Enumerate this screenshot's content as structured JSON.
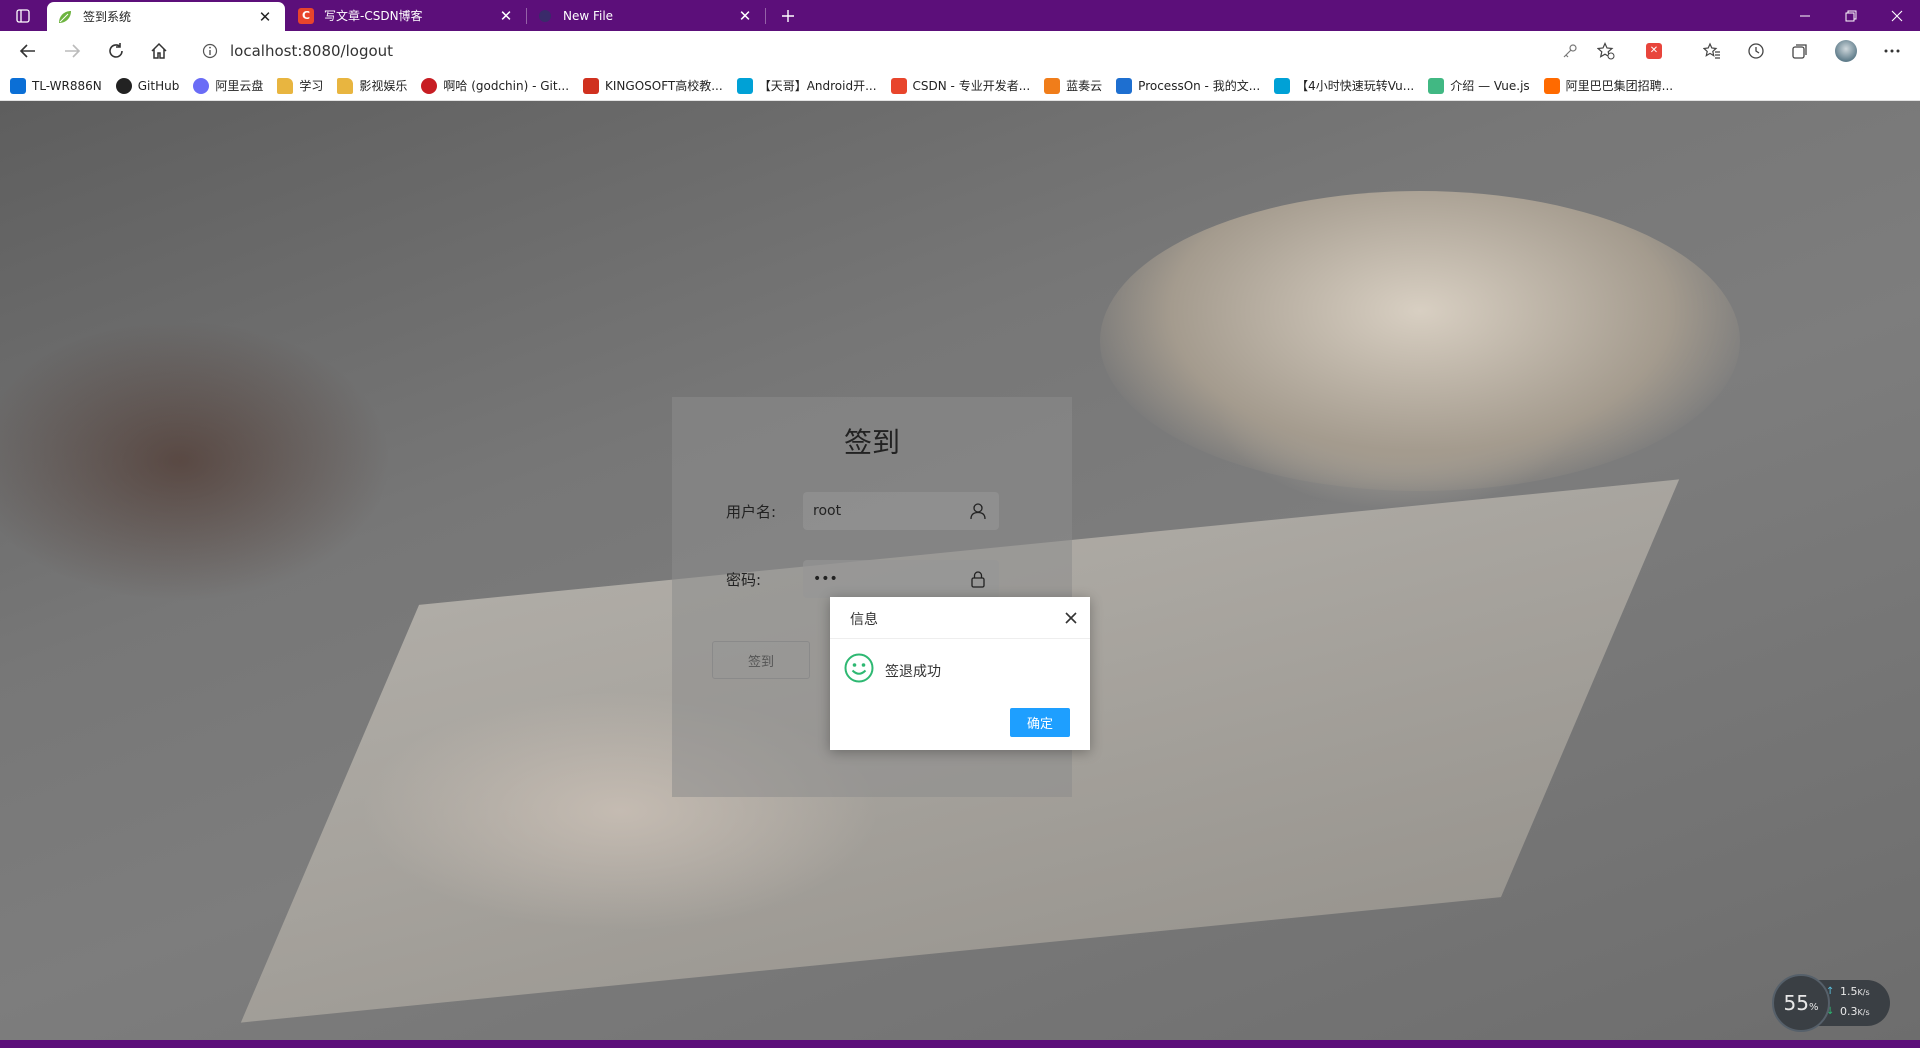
{
  "tabs": [
    {
      "label": "签到系统",
      "active": true
    },
    {
      "label": "写文章-CSDN博客",
      "active": false
    },
    {
      "label": "New File",
      "active": false
    }
  ],
  "address": {
    "url": "localhost:8080/logout"
  },
  "bookmarks": [
    {
      "label": "TL-WR886N",
      "icon": "tplink-icon",
      "color": "#0b6fd6"
    },
    {
      "label": "GitHub",
      "icon": "github-icon",
      "color": "#222222"
    },
    {
      "label": "阿里云盘",
      "icon": "aliyun-drive-icon",
      "color": "#6a6cf6"
    },
    {
      "label": "学习",
      "icon": "folder-icon",
      "color": "#e8b540"
    },
    {
      "label": "影视娱乐",
      "icon": "folder-icon",
      "color": "#e8b540"
    },
    {
      "label": "啊哈 (godchin) - Git...",
      "icon": "gitee-icon",
      "color": "#c71d23"
    },
    {
      "label": "KINGOSOFT高校教...",
      "icon": "kingosoft-icon",
      "color": "#d0311f"
    },
    {
      "label": "【天哥】Android开...",
      "icon": "bilibili-icon",
      "color": "#00a1d6"
    },
    {
      "label": "CSDN - 专业开发者...",
      "icon": "csdn-icon",
      "color": "#e8452c"
    },
    {
      "label": "蓝奏云",
      "icon": "lanzou-icon",
      "color": "#f07d1a"
    },
    {
      "label": "ProcessOn - 我的文...",
      "icon": "processon-icon",
      "color": "#1e6fd0"
    },
    {
      "label": "【4小时快速玩转Vu...",
      "icon": "bilibili-icon",
      "color": "#00a1d6"
    },
    {
      "label": "介绍 — Vue.js",
      "icon": "vue-icon",
      "color": "#41b883"
    },
    {
      "label": "阿里巴巴集团招聘...",
      "icon": "alibaba-icon",
      "color": "#ff6a00"
    }
  ],
  "card": {
    "title": "签到",
    "username_label": "用户名:",
    "username_value": "root",
    "password_label": "密码:",
    "password_value": "•••",
    "signin_label": "签到"
  },
  "dialog": {
    "title": "信息",
    "message": "签退成功",
    "ok_label": "确定"
  },
  "network": {
    "usage_percent": 55,
    "percent_unit": "%",
    "upload": "1.5",
    "upload_unit": "K/s",
    "download": "0.3",
    "download_unit": "K/s"
  },
  "colors": {
    "tabbar": "#5c0f7a",
    "ok_button": "#1e9fff",
    "smile": "#2eb872"
  }
}
